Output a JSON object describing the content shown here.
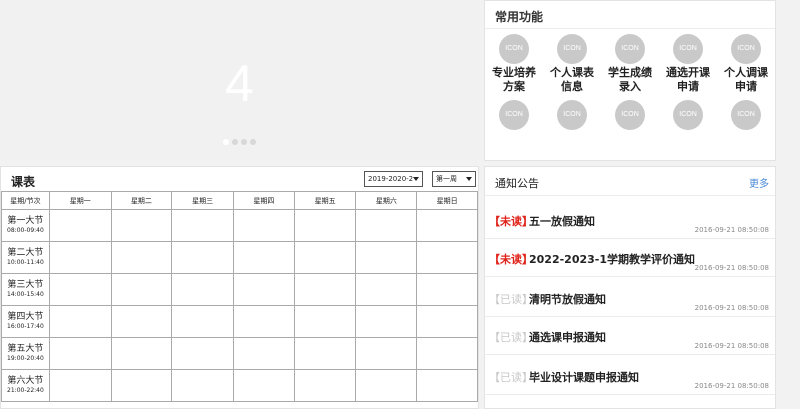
{
  "carousel": {
    "slide_number": "4",
    "dot_count": 4,
    "active_dot": 0
  },
  "functions": {
    "title": "常用功能",
    "icon_text": "ICON",
    "items": [
      {
        "label_l1": "专业培养",
        "label_l2": "方案"
      },
      {
        "label_l1": "个人课表",
        "label_l2": "信息"
      },
      {
        "label_l1": "学生成绩",
        "label_l2": "录入"
      },
      {
        "label_l1": "通选开课",
        "label_l2": "申请"
      },
      {
        "label_l1": "个人调课",
        "label_l2": "申请"
      },
      {
        "label_l1": "",
        "label_l2": ""
      },
      {
        "label_l1": "",
        "label_l2": ""
      },
      {
        "label_l1": "",
        "label_l2": ""
      },
      {
        "label_l1": "",
        "label_l2": ""
      },
      {
        "label_l1": "",
        "label_l2": ""
      }
    ]
  },
  "schedule": {
    "title": "课表",
    "term_select": "2019-2020-2",
    "week_select": "第一周",
    "headers": [
      "星期/节次",
      "星期一",
      "星期二",
      "星期三",
      "星期四",
      "星期五",
      "星期六",
      "星期日"
    ],
    "periods": [
      {
        "name": "第一大节",
        "time": "08:00-09:40"
      },
      {
        "name": "第二大节",
        "time": "10:00-11:40"
      },
      {
        "name": "第三大节",
        "time": "14:00-15:40"
      },
      {
        "name": "第四大节",
        "time": "16:00-17:40"
      },
      {
        "name": "第五大节",
        "time": "19:00-20:40"
      },
      {
        "name": "第六大节",
        "time": "21:00-22:40"
      }
    ]
  },
  "notices": {
    "title": "通知公告",
    "more": "更多",
    "items": [
      {
        "tag": "【未读】",
        "read": false,
        "text": "五一放假通知",
        "date": "2016-09-21  08:50:08"
      },
      {
        "tag": "【未读】",
        "read": false,
        "text": "2022-2023-1学期教学评价通知",
        "date": "2016-09-21  08:50:08"
      },
      {
        "tag": "【已读】",
        "read": true,
        "text": "清明节放假通知",
        "date": "2016-09-21  08:50:08"
      },
      {
        "tag": "【已读】",
        "read": true,
        "text": "通选课申报通知",
        "date": "2016-09-21  08:50:08"
      },
      {
        "tag": "【已读】",
        "read": true,
        "text": "毕业设计课题申报通知",
        "date": "2016-09-21  08:50:08"
      }
    ]
  },
  "colors": {
    "unread_tag": "#e0241b",
    "read_tag": "#c8c8c8",
    "more_link": "#4a8ad6",
    "icon_circle": "#c9c9c9"
  }
}
